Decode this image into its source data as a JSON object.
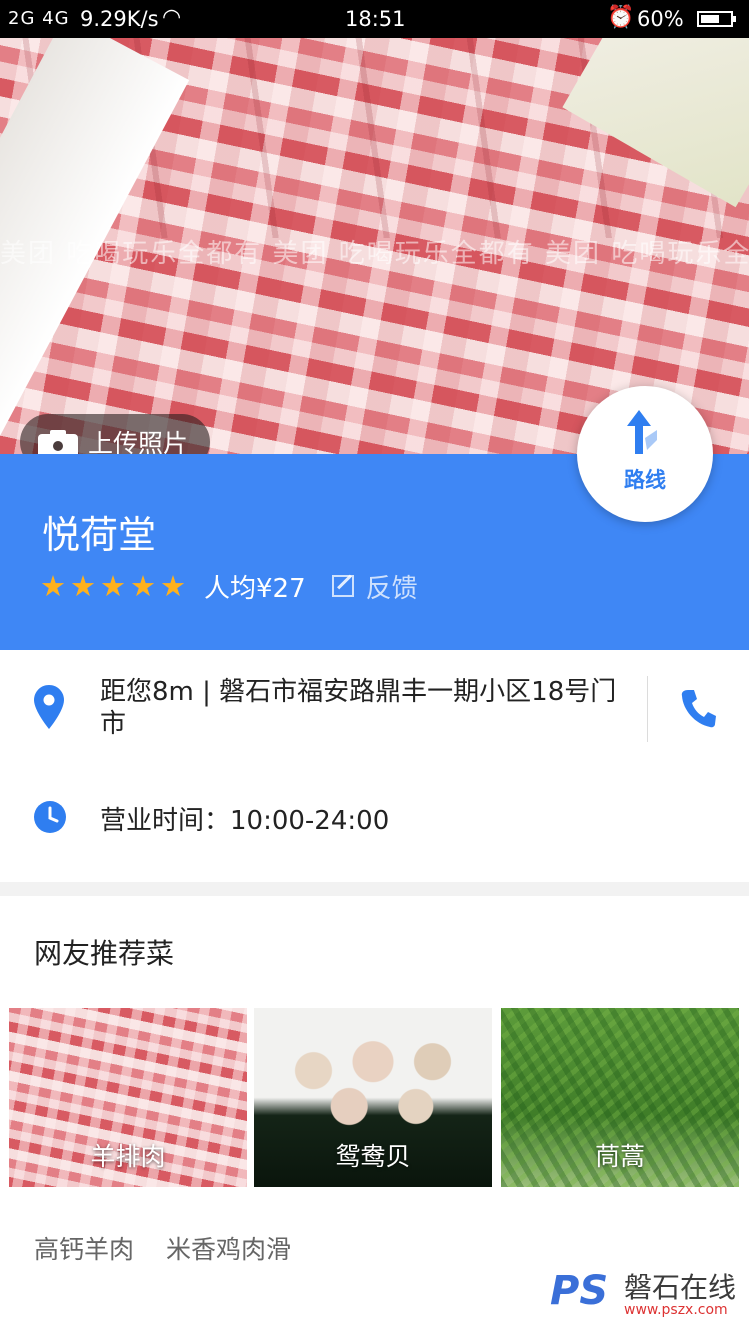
{
  "status_bar": {
    "signal": "2G 4G",
    "network_speed": "9.29K/s",
    "time": "18:51",
    "battery": "60%"
  },
  "hero": {
    "watermark": "美团 吃喝玩乐全都有 美团 吃喝玩乐全都有 美团 吃喝玩乐全都有 美团 吃喝玩乐全都有",
    "upload_label": "上传照片"
  },
  "shop": {
    "name": "悦荷堂",
    "rating": 5,
    "avg_price": "人均¥27",
    "feedback_label": "反馈",
    "route_label": "路线"
  },
  "details": {
    "address": "距您8m | 磐石市福安路鼎丰一期小区18号门市",
    "hours": "营业时间：10:00-24:00"
  },
  "recommend": {
    "title": "网友推荐菜",
    "dishes": [
      {
        "name": "羊排肉"
      },
      {
        "name": "鸳鸯贝"
      },
      {
        "name": "茼蒿"
      }
    ],
    "tags": [
      "高钙羊肉",
      "米香鸡肉滑"
    ]
  },
  "footer_logo": {
    "mark": "PS",
    "site_name": "磐石在线",
    "url": "www.pszx.com"
  },
  "colors": {
    "primary": "#3f87f5",
    "star": "#ffb11b"
  }
}
